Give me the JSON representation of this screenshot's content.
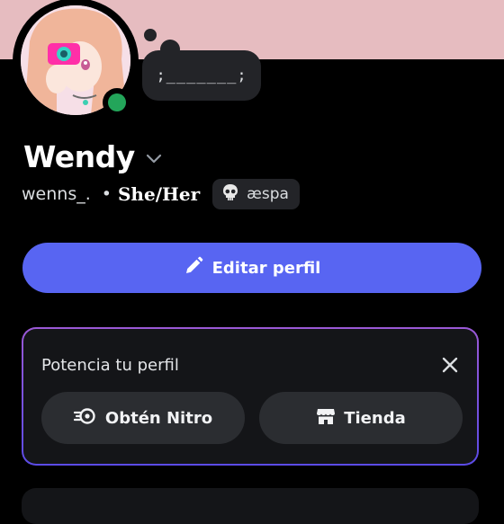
{
  "profile": {
    "display_name": "Wendy",
    "username": "wenns_.",
    "separator": "•",
    "pronouns": "She/Her",
    "clan_tag": "æspa",
    "status_bubble": ";_______;",
    "status": "online"
  },
  "actions": {
    "edit_profile": "Editar perfil"
  },
  "boost_card": {
    "title": "Potencia tu perfil",
    "nitro_label": "Obtén Nitro",
    "shop_label": "Tienda"
  },
  "colors": {
    "banner": "#e6bcc0",
    "accent": "#5865f2",
    "online": "#23a55a",
    "card_border_top": "#9b59d6",
    "card_border_bottom": "#5b4be6"
  },
  "icons": [
    "chevron-down-icon",
    "skull-icon",
    "pencil-icon",
    "close-icon",
    "nitro-icon",
    "shop-icon"
  ]
}
